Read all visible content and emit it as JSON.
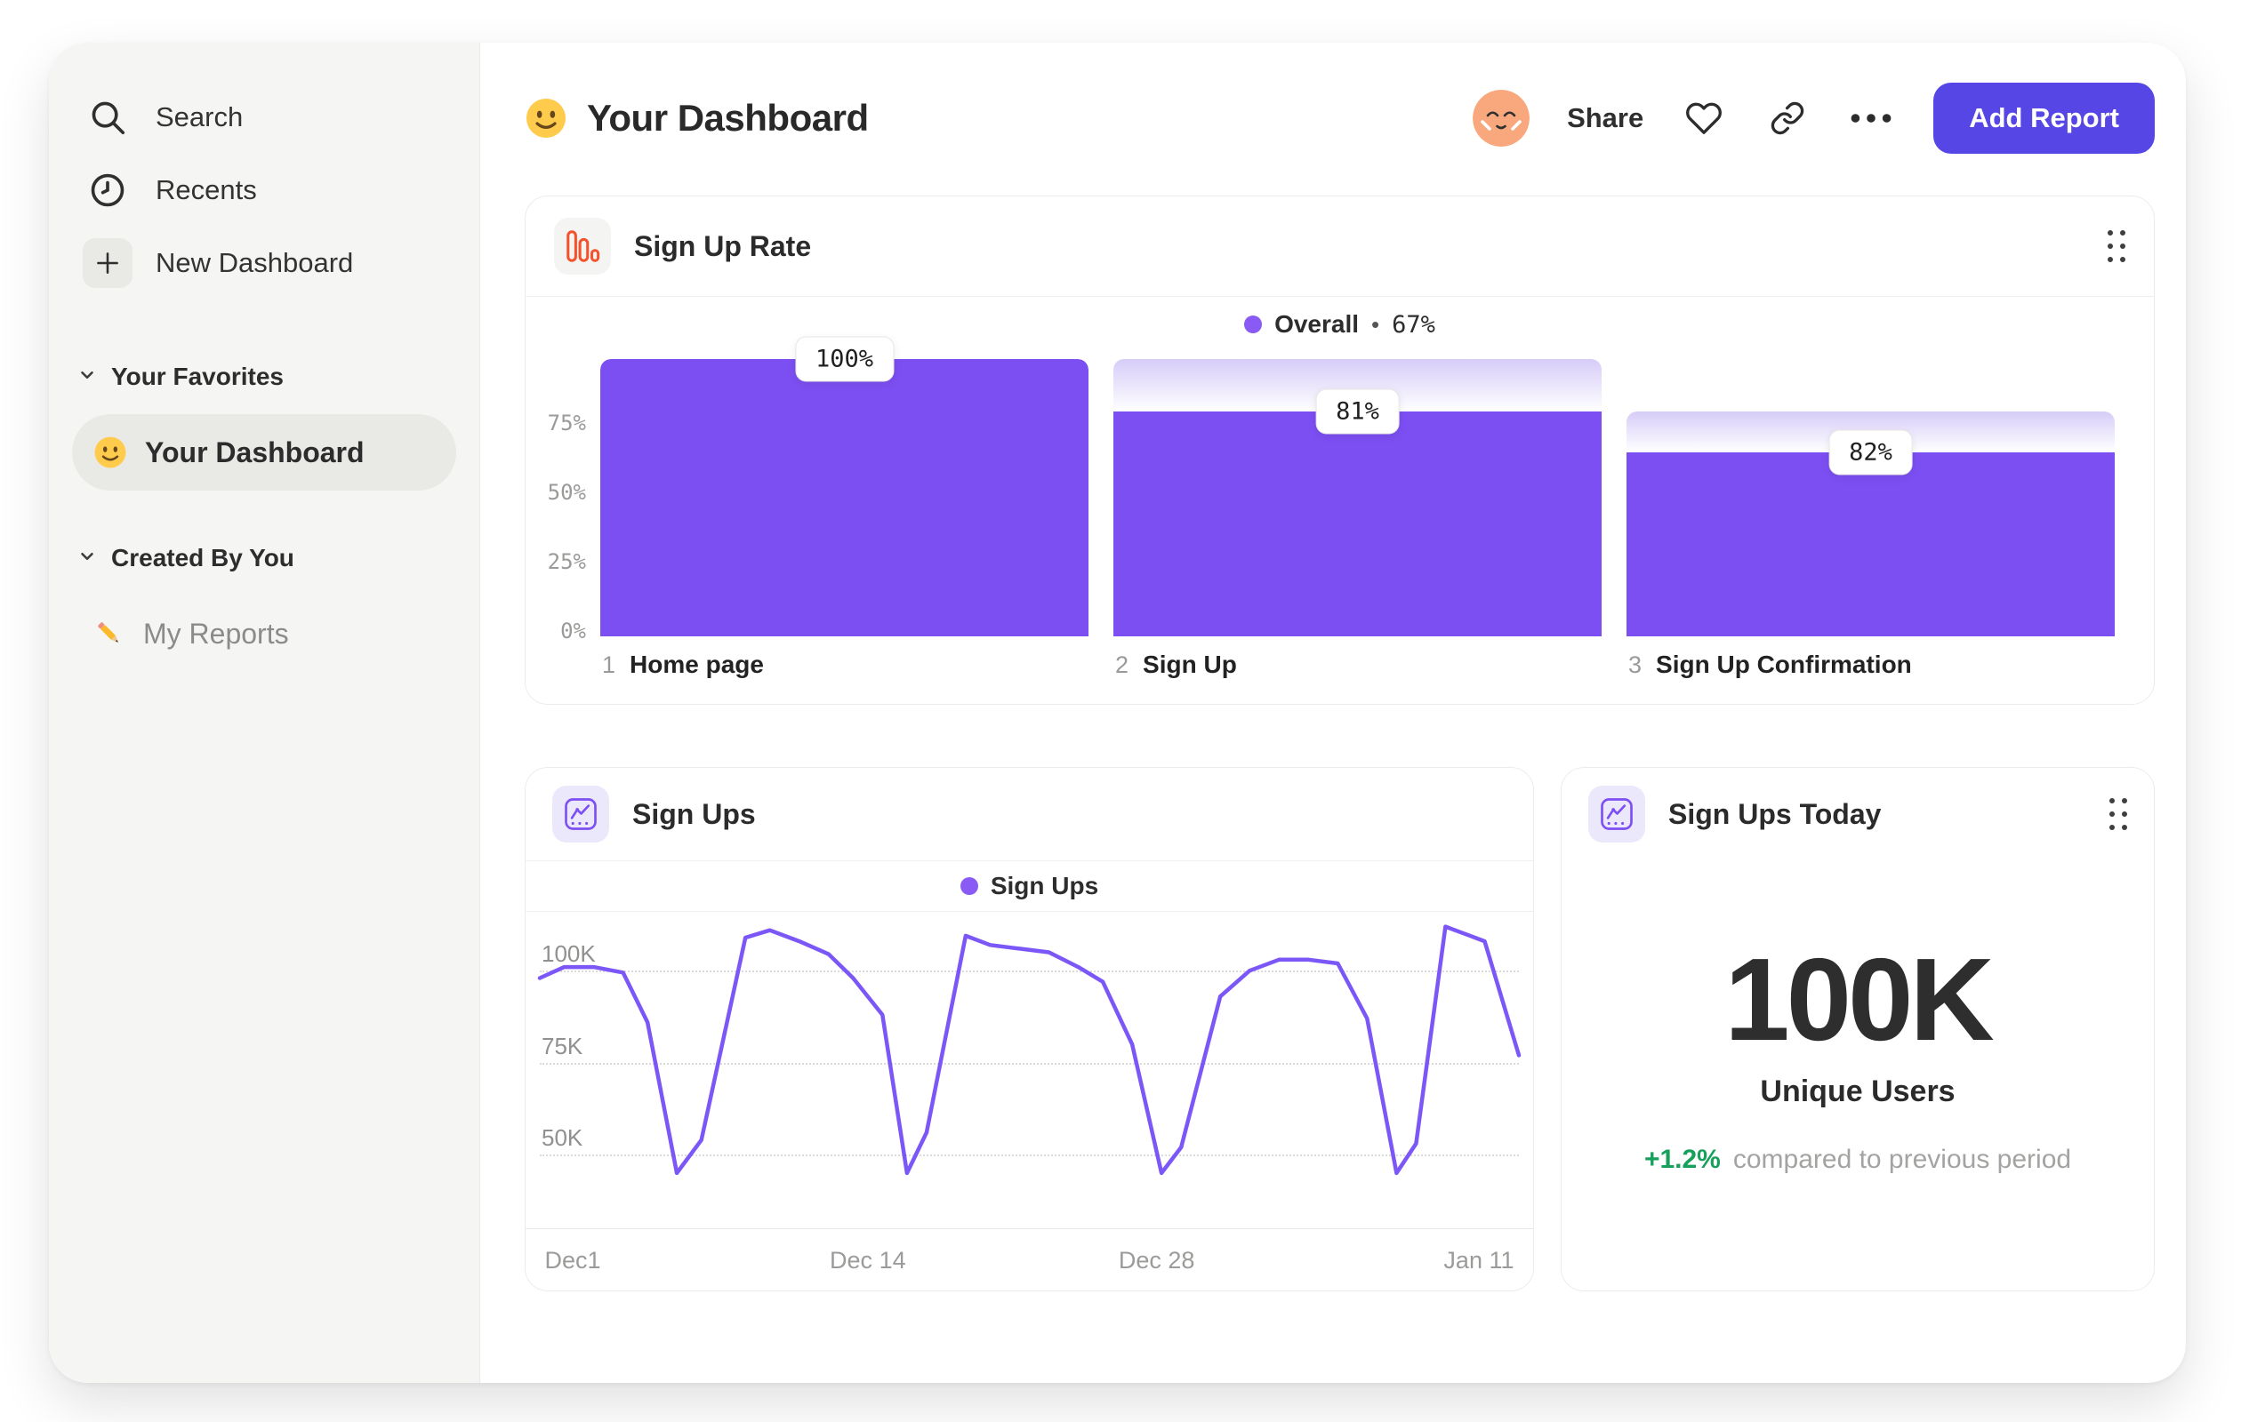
{
  "colors": {
    "accent_button": "#5646e5",
    "bar_purple": "#7c4ff2",
    "bar_gradient_top": "#d6ccf8",
    "line_purple": "#7b57f7",
    "legend_dot": "#8a5bf4",
    "delta_green": "#16a05c",
    "funnel_icon_orange": "#f4522d",
    "sidebar_bg": "#f5f5f3"
  },
  "sidebar": {
    "items": [
      {
        "label": "Search",
        "icon": "search-icon"
      },
      {
        "label": "Recents",
        "icon": "clock-icon"
      },
      {
        "label": "New Dashboard",
        "icon": "plus-icon"
      }
    ],
    "sections": [
      {
        "title": "Your Favorites",
        "items": [
          {
            "emoji": "smiley-face",
            "label": "Your Dashboard",
            "selected": true
          }
        ]
      },
      {
        "title": "Created By You",
        "items": [
          {
            "emoji": "pencil",
            "label": "My Reports",
            "selected": false
          }
        ]
      }
    ]
  },
  "header": {
    "emoji": "smiley-face",
    "title": "Your Dashboard",
    "share_label": "Share",
    "add_report_label": "Add Report"
  },
  "cards": {
    "funnel": {
      "title": "Sign Up Rate",
      "legend": {
        "label": "Overall",
        "separator": "•",
        "value": "67%"
      }
    },
    "line": {
      "title": "Sign Ups",
      "legend_label": "Sign Ups"
    },
    "today": {
      "title": "Sign Ups Today",
      "value": "100K",
      "unit": "Unique Users",
      "delta": "+1.2%",
      "delta_note": "compared to previous period"
    }
  },
  "chart_data": [
    {
      "type": "bar",
      "subtype": "funnel",
      "title": "Sign Up Rate",
      "overall_conversion": "67%",
      "ylim": [
        0,
        100
      ],
      "y_ticks": [
        {
          "label": "75%",
          "value": 75
        },
        {
          "label": "50%",
          "value": 50
        },
        {
          "label": "25%",
          "value": 25
        },
        {
          "label": "0%",
          "value": 0
        }
      ],
      "steps": [
        {
          "index": "1",
          "name": "Home page",
          "step_conversion_pct": 100,
          "cumulative_pct": 100,
          "prev_cumulative_pct": 100
        },
        {
          "index": "2",
          "name": "Sign Up",
          "step_conversion_pct": 81,
          "cumulative_pct": 81,
          "prev_cumulative_pct": 100
        },
        {
          "index": "3",
          "name": "Sign Up Confirmation",
          "step_conversion_pct": 82,
          "cumulative_pct": 66.4,
          "prev_cumulative_pct": 81
        }
      ]
    },
    {
      "type": "line",
      "title": "Sign Ups",
      "legend_position": "top-center",
      "grid": "dotted-horizontal",
      "value_range": [
        30,
        116
      ],
      "y_ticks": [
        {
          "label": "100K",
          "value": 100
        },
        {
          "label": "75K",
          "value": 75
        },
        {
          "label": "50K",
          "value": 50
        }
      ],
      "x_ticks": [
        {
          "label": "Dec1",
          "pct": 0.5
        },
        {
          "label": "Dec 14",
          "pct": 33.5
        },
        {
          "label": "Dec 28",
          "pct": 63
        },
        {
          "label": "Jan 11",
          "pct": 99.5
        }
      ],
      "series": [
        {
          "name": "Sign Ups",
          "points": [
            [
              0,
              98
            ],
            [
              2.5,
              101
            ],
            [
              5.5,
              101
            ],
            [
              8.5,
              99.5
            ],
            [
              11,
              86
            ],
            [
              14,
              45
            ],
            [
              16.5,
              54
            ],
            [
              21,
              109
            ],
            [
              23.5,
              111
            ],
            [
              26.5,
              108
            ],
            [
              29.5,
              104.5
            ],
            [
              32,
              98
            ],
            [
              35,
              88
            ],
            [
              37.5,
              45
            ],
            [
              39.5,
              56
            ],
            [
              43.5,
              109.5
            ],
            [
              46,
              107
            ],
            [
              49,
              106
            ],
            [
              52,
              105
            ],
            [
              55,
              101
            ],
            [
              57.5,
              97
            ],
            [
              60.5,
              80
            ],
            [
              63.5,
              45
            ],
            [
              65.5,
              52
            ],
            [
              69.5,
              93
            ],
            [
              72.5,
              100
            ],
            [
              75.5,
              103
            ],
            [
              78.5,
              103
            ],
            [
              81.5,
              102
            ],
            [
              84.5,
              87
            ],
            [
              87.5,
              45
            ],
            [
              89.5,
              53
            ],
            [
              92.5,
              112
            ],
            [
              94.5,
              110
            ],
            [
              96.5,
              108
            ],
            [
              100,
              77
            ]
          ]
        }
      ]
    },
    {
      "type": "big-number",
      "title": "Sign Ups Today",
      "value": "100K",
      "label": "Unique Users",
      "delta_pct": "+1.2%",
      "comparison": "compared to previous period"
    }
  ]
}
